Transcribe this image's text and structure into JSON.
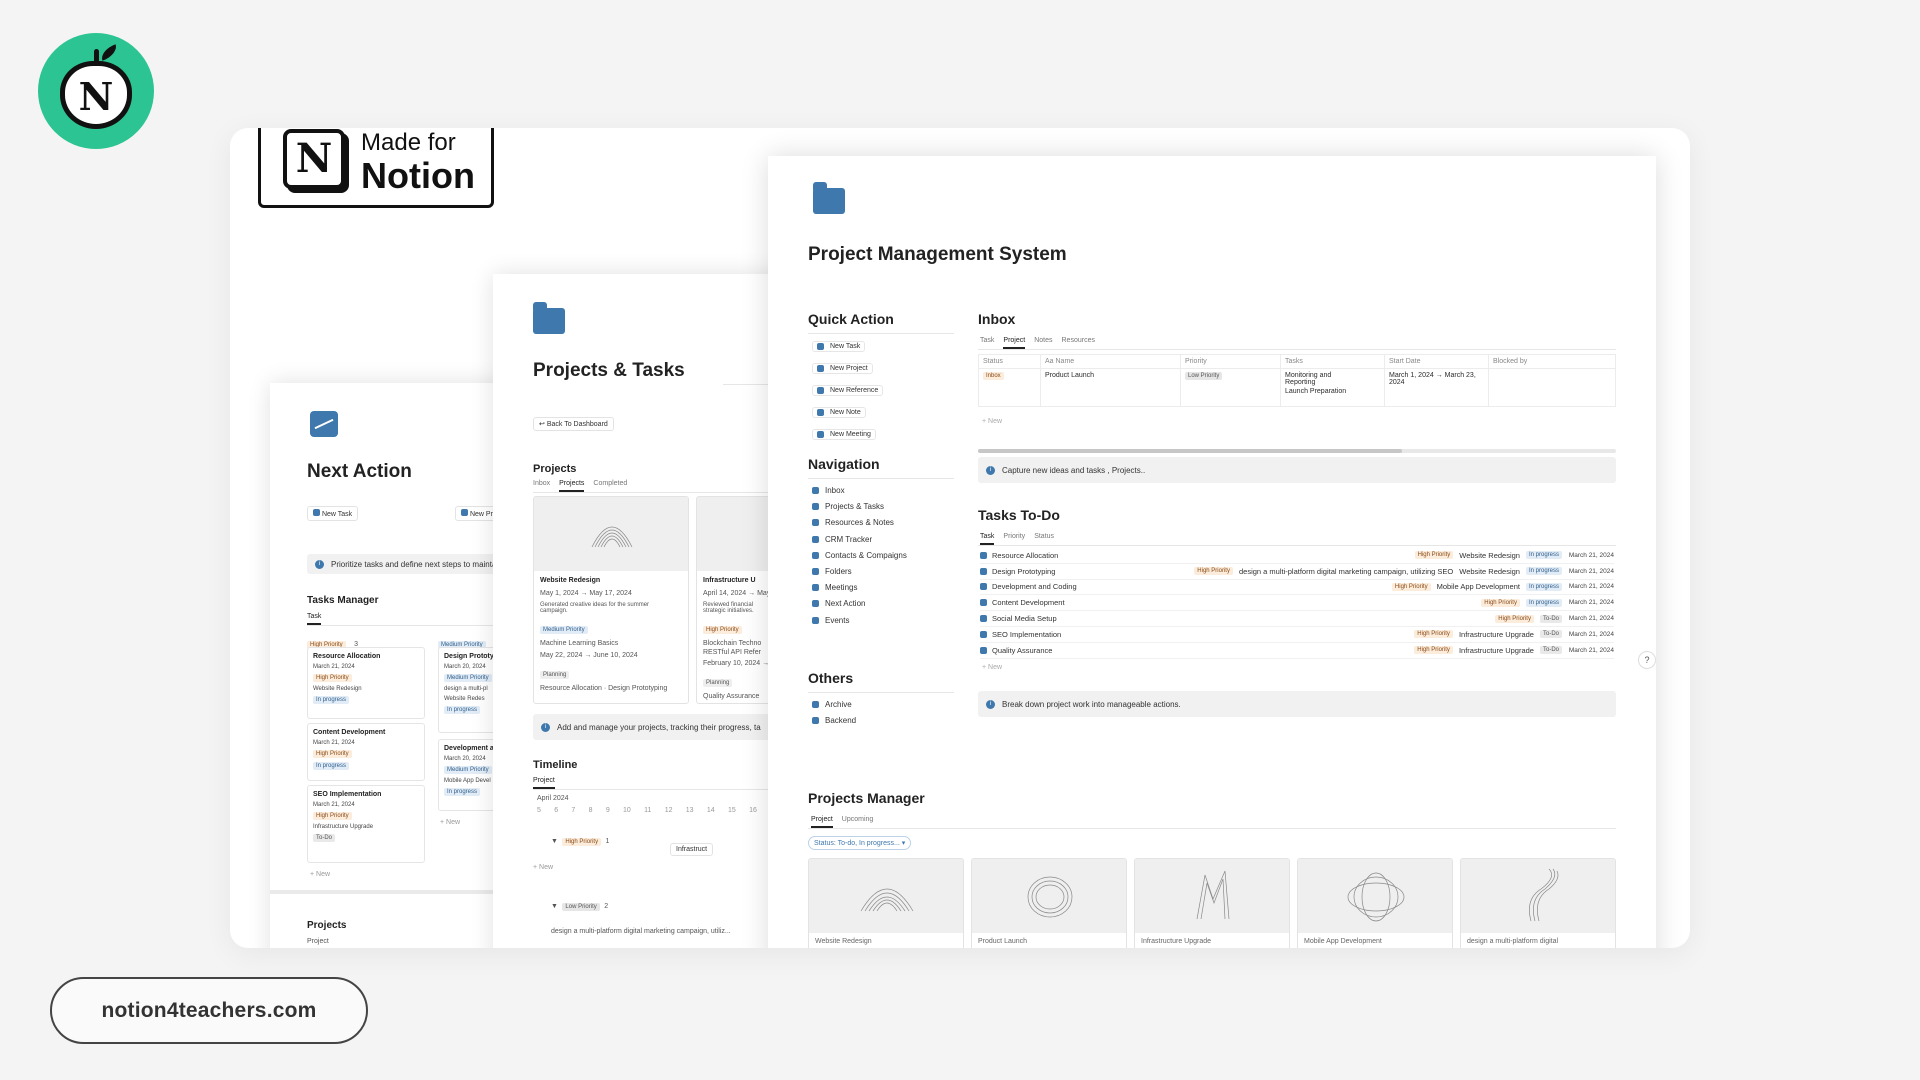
{
  "brand": {
    "logo_letter": "N",
    "site": "notion4teachers.com"
  },
  "badge": {
    "line1": "Made for",
    "line2": "Notion",
    "logo_letter": "N"
  },
  "next_action": {
    "title": "Next Action",
    "buttons": [
      "New Task",
      "New Pr"
    ],
    "callout": "Prioritize tasks and define next steps to maintain m",
    "tasks_manager": "Tasks Manager",
    "tab": "Task",
    "groups": [
      {
        "label": "High Priority",
        "count": "3",
        "cards": [
          {
            "name": "Resource Allocation",
            "date": "March 21, 2024",
            "priority": "High Priority",
            "project": "Website Redesign",
            "status": "In progress"
          },
          {
            "name": "Content Development",
            "date": "March 21, 2024",
            "priority": "High Priority",
            "project": "",
            "status": "In progress"
          },
          {
            "name": "SEO Implementation",
            "date": "March 21, 2024",
            "priority": "High Priority",
            "project": "Infrastructure Upgrade",
            "status": "To-Do"
          }
        ]
      },
      {
        "label": "Medium Priority",
        "cards": [
          {
            "name": "Design Prototy",
            "date": "March 20, 2024",
            "priority": "Medium Priority",
            "project": "design a multi-pl",
            "project2": "Website Redes",
            "status": "In progress"
          },
          {
            "name": "Development a",
            "date": "March 20, 2024",
            "priority": "Medium Priority",
            "project": "Mobile App Devel",
            "status": "In progress"
          }
        ]
      }
    ],
    "new": "+ New",
    "projects": "Projects",
    "project_tab": "Project"
  },
  "projects_tasks": {
    "title": "Projects & Tasks",
    "back": "Back To Dashboard",
    "projects": "Projects",
    "tabs": [
      "Inbox",
      "Projects",
      "Completed"
    ],
    "card1": {
      "name": "Website Redesign",
      "dates": "May 1, 2024 → May 17, 2024",
      "desc1": "Generated creative ideas for the summer",
      "desc2": "campaign.",
      "priority": "Medium Priority",
      "task": "Machine Learning Basics",
      "dates2": "May 22, 2024 → June 10, 2024",
      "status": "Planning",
      "link1": "Resource Allocation",
      "link2": "Design Prototyping"
    },
    "card2": {
      "name": "Infrastructure U",
      "dates": "April 14, 2024 → May",
      "desc1": "Reviewed financial",
      "desc2": "strategic initiatives.",
      "priority": "High Priority",
      "task1": "Blockchain Techno",
      "task2": "RESTful API Refer",
      "dates2": "February 10, 2024 → M",
      "status": "Planning",
      "link1": "Quality Assurance"
    },
    "callout": "Add and manage your projects, tracking their progress, ta",
    "timeline": "Timeline",
    "timeline_tab": "Project",
    "month": "April 2024",
    "days": [
      "5",
      "6",
      "7",
      "8",
      "9",
      "10",
      "11",
      "12",
      "13",
      "14",
      "15",
      "16"
    ],
    "group_high": "High Priority",
    "group_high_count": "1",
    "bar_label": "Infrastruct",
    "new": "+ New",
    "group_low": "Low Priority",
    "group_low_count": "2",
    "low_item": "design a multi-platform digital marketing campaign, utiliz..."
  },
  "pms": {
    "title": "Project Management System",
    "quick_action": "Quick Action",
    "quick_items": [
      "New Task",
      "New Project",
      "New Reference",
      "New Note",
      "New Meeting"
    ],
    "navigation": "Navigation",
    "nav_items": [
      "Inbox",
      "Projects & Tasks",
      "Resources & Notes",
      "CRM Tracker",
      "Contacts & Compaigns",
      "Folders",
      "Meetings",
      "Next Action",
      "Events"
    ],
    "others": "Others",
    "other_items": [
      "Archive",
      "Backend"
    ],
    "inbox": "Inbox",
    "inbox_tabs": [
      "Task",
      "Project",
      "Notes",
      "Resources"
    ],
    "inbox_cols": [
      "Status",
      "Aa Name",
      "Priority",
      "Tasks",
      "Start Date",
      "Blocked by"
    ],
    "inbox_row": {
      "status": "Inbox",
      "name": "Product Launch",
      "priority": "Low Priority",
      "task1": "Monitoring and",
      "task1b": "Reporting",
      "task2": "Launch Preparation",
      "date1": "March 1, 2024 → March 23,",
      "date2": "2024"
    },
    "inbox_new": "+ New",
    "callout1": "Capture new ideas and tasks , Projects..",
    "tasks_todo": "Tasks To-Do",
    "todo_tabs": [
      "Task",
      "Priority",
      "Status"
    ],
    "tasks": [
      {
        "name": "Resource Allocation",
        "extra": "",
        "priority": "High Priority",
        "project": "Website Redesign",
        "status": "In progress",
        "date": "March 21, 2024"
      },
      {
        "name": "Design Prototyping",
        "extra": "design a multi-platform digital marketing campaign, utilizing SEO",
        "priority": "High Priority",
        "project": "Website Redesign",
        "status": "In progress",
        "date": "March 21, 2024"
      },
      {
        "name": "Development and Coding",
        "extra": "",
        "priority": "High Priority",
        "project": "Mobile App Development",
        "status": "In progress",
        "date": "March 21, 2024"
      },
      {
        "name": "Content Development",
        "extra": "",
        "priority": "High Priority",
        "project": "",
        "status": "In progress",
        "date": "March 21, 2024"
      },
      {
        "name": "Social Media Setup",
        "extra": "",
        "priority": "High Priority",
        "project": "",
        "status": "To-Do",
        "date": "March 21, 2024"
      },
      {
        "name": "SEO Implementation",
        "extra": "",
        "priority": "High Priority",
        "project": "Infrastructure Upgrade",
        "status": "To-Do",
        "date": "March 21, 2024"
      },
      {
        "name": "Quality Assurance",
        "extra": "",
        "priority": "High Priority",
        "project": "Infrastructure Upgrade",
        "status": "To-Do",
        "date": "March 21, 2024"
      }
    ],
    "todo_new": "+ New",
    "callout2": "Break down project work into manageable actions.",
    "projects_manager": "Projects Manager",
    "pm_tabs": [
      "Project",
      "Upcoming"
    ],
    "filter": "Status: To-do, In progress...",
    "covers": [
      "Website Redesign",
      "Product Launch",
      "Infrastructure Upgrade",
      "Mobile App Development",
      "design a multi-platform digital"
    ],
    "help": "?"
  },
  "colors": {
    "accent": "#3f78ad",
    "brand_green": "#2cc492"
  }
}
